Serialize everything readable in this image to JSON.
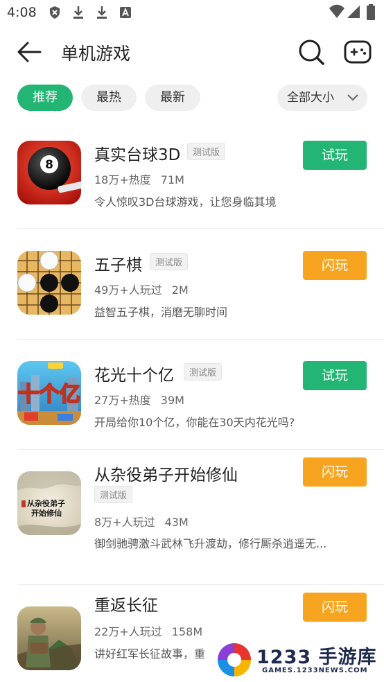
{
  "status_bar": {
    "time": "4:08"
  },
  "header": {
    "title": "单机游戏"
  },
  "tabs": [
    {
      "label": "推荐",
      "active": true
    },
    {
      "label": "最热",
      "active": false
    },
    {
      "label": "最新",
      "active": false
    }
  ],
  "size_filter": {
    "label": "全部大小"
  },
  "games": [
    {
      "name": "真实台球3D",
      "badge": "测试版",
      "popularity": "18万+热度",
      "size": "71M",
      "description": "令人惊叹3D台球游戏，让您身临其境",
      "button": "试玩",
      "button_color": "#22b573",
      "icon": "billiard-8-ball-icon"
    },
    {
      "name": "五子棋",
      "badge": "测试版",
      "popularity": "49万+人玩过",
      "size": "2M",
      "description": "益智五子棋，消磨无聊时间",
      "button": "闪玩",
      "button_color": "#f7a521",
      "icon": "gomoku-board-icon"
    },
    {
      "name": "花光十个亿",
      "badge": "测试版",
      "popularity": "27万+热度",
      "size": "39M",
      "description": "开局给你10个亿，你能在30天内花光吗?",
      "button": "试玩",
      "button_color": "#22b573",
      "icon": "money-city-icon"
    },
    {
      "name": "从杂役弟子开始修仙",
      "badge": "测试版",
      "popularity": "8万+人玩过",
      "size": "43M",
      "description": "御剑驰骋激斗武林飞升渡劫，修行厮杀逍遥无...",
      "button": "闪玩",
      "button_color": "#f7a521",
      "icon": "calligraphy-scroll-icon",
      "icon_text_line1": "从杂役弟子",
      "icon_text_line2": "开始修仙"
    },
    {
      "name": "重返长征",
      "badge": "",
      "popularity": "22万+人玩过",
      "size": "158M",
      "description": "讲好红军长征故事，重",
      "button": "闪玩",
      "button_color": "#f7a521",
      "icon": "soldier-icon"
    }
  ],
  "watermark": {
    "text": "1233 手游库",
    "subtext": "GAMES.1233NEWS.COM"
  }
}
